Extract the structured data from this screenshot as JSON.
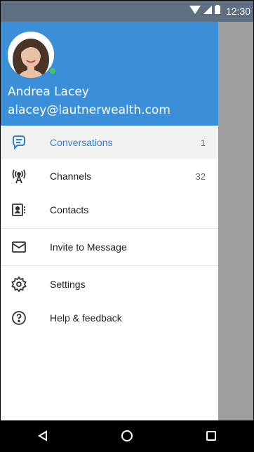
{
  "status_bar": {
    "time": "12:30"
  },
  "drawer_header": {
    "user_name": "Andrea Lacey",
    "user_email": "alacey@lautnerwealth.com",
    "status": "online"
  },
  "menu": {
    "items": [
      {
        "label": "Conversations",
        "count": "1",
        "icon": "chat-bubble-icon"
      },
      {
        "label": "Channels",
        "count": "32",
        "icon": "broadcast-tower-icon"
      },
      {
        "label": "Contacts",
        "count": "",
        "icon": "contact-card-icon"
      },
      {
        "label": "Invite to Message",
        "count": "",
        "icon": "envelope-icon"
      },
      {
        "label": "Settings",
        "count": "",
        "icon": "gear-icon"
      },
      {
        "label": "Help & feedback",
        "count": "",
        "icon": "help-circle-icon"
      }
    ]
  },
  "colors": {
    "header": "#3a8fd8",
    "active_text": "#2b7fd0",
    "online": "#45c35e"
  }
}
